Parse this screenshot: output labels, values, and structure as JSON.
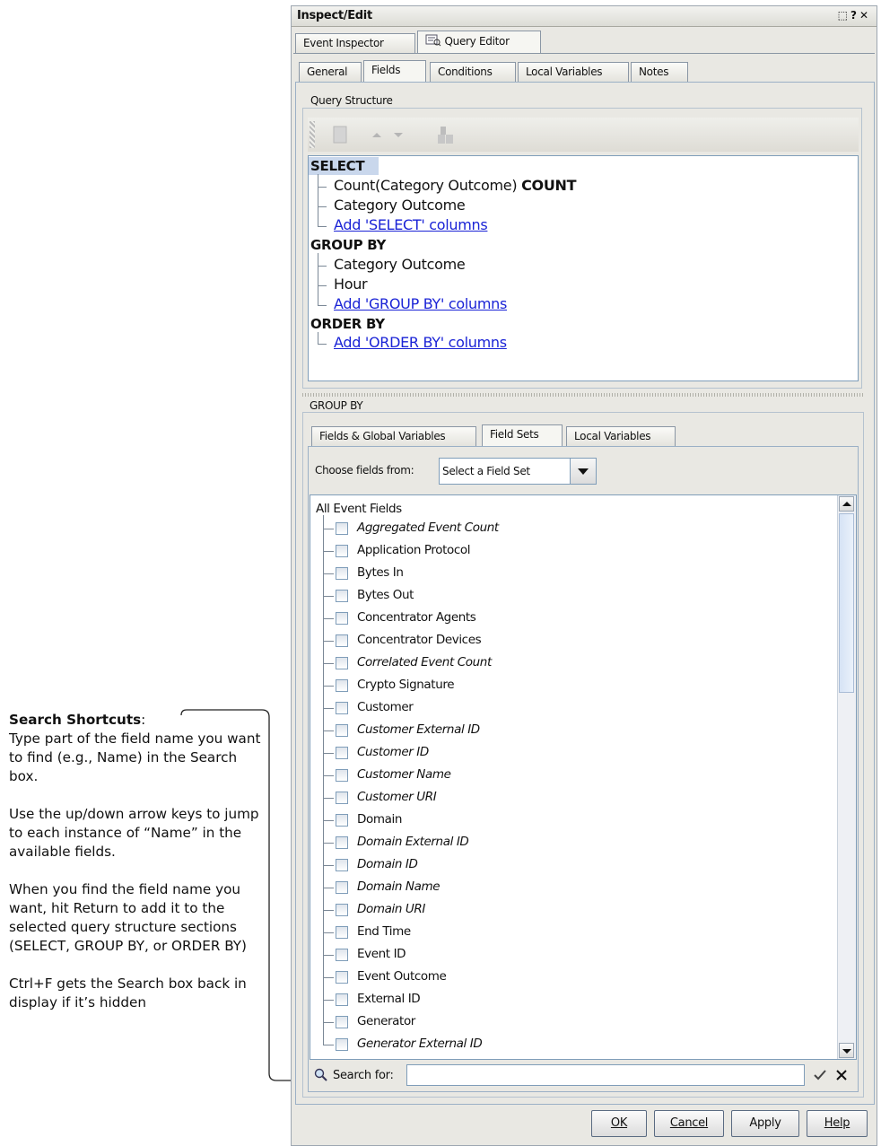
{
  "annotation": {
    "heading": "Search Shortcuts",
    "p1": "Type part of the field name you want to find (e.g., Name) in the Search box.",
    "p2": "Use the up/down arrow keys to jump to each instance of “Name” in the available fields.",
    "p3": "When you find the field name you want, hit Return to add it to the selected query structure sections (SELECT, GROUP BY, or ORDER BY)",
    "p4": "Ctrl+F gets the Search box back in display  if it’s hidden"
  },
  "window": {
    "title": "Inspect/Edit",
    "controls": "⬚ ? ×"
  },
  "top_tabs": [
    "Event Inspector",
    "Query Editor"
  ],
  "sub_tabs": [
    "General",
    "Fields",
    "Conditions",
    "Local Variables",
    "Notes"
  ],
  "query_structure": {
    "legend": "Query Structure",
    "select_kw": "SELECT",
    "select_items": [
      "Count(Category Outcome)",
      "Category Outcome"
    ],
    "count_alias": "COUNT",
    "add_select": "Add 'SELECT' columns",
    "groupby_kw": "GROUP BY",
    "groupby_items": [
      "Category Outcome",
      "Hour"
    ],
    "add_groupby": "Add 'GROUP BY' columns",
    "orderby_kw": "ORDER BY",
    "add_orderby": "Add 'ORDER BY' columns"
  },
  "group_by": {
    "legend": "GROUP BY",
    "tabs": [
      "Fields & Global Variables",
      "Field Sets",
      "Local Variables"
    ],
    "choose_label": "Choose fields from:",
    "select_value": "Select a Field Set",
    "tree_root": "All Event Fields",
    "fields": [
      {
        "label": "Aggregated Event Count",
        "italic": true
      },
      {
        "label": "Application Protocol",
        "italic": false
      },
      {
        "label": "Bytes In",
        "italic": false
      },
      {
        "label": "Bytes Out",
        "italic": false
      },
      {
        "label": "Concentrator Agents",
        "italic": false
      },
      {
        "label": "Concentrator Devices",
        "italic": false
      },
      {
        "label": "Correlated Event Count",
        "italic": true
      },
      {
        "label": "Crypto Signature",
        "italic": false
      },
      {
        "label": "Customer",
        "italic": false
      },
      {
        "label": "Customer External ID",
        "italic": true
      },
      {
        "label": "Customer ID",
        "italic": true
      },
      {
        "label": "Customer Name",
        "italic": true
      },
      {
        "label": "Customer URI",
        "italic": true
      },
      {
        "label": "Domain",
        "italic": false
      },
      {
        "label": "Domain External ID",
        "italic": true
      },
      {
        "label": "Domain ID",
        "italic": true
      },
      {
        "label": "Domain Name",
        "italic": true
      },
      {
        "label": "Domain URI",
        "italic": true
      },
      {
        "label": "End Time",
        "italic": false
      },
      {
        "label": "Event ID",
        "italic": false
      },
      {
        "label": "Event Outcome",
        "italic": false
      },
      {
        "label": "External ID",
        "italic": false
      },
      {
        "label": "Generator",
        "italic": false
      },
      {
        "label": "Generator External ID",
        "italic": true
      }
    ],
    "search_label": "Search for:",
    "search_value": ""
  },
  "buttons": {
    "ok": "OK",
    "cancel": "Cancel",
    "apply": "Apply",
    "help": "Help"
  }
}
